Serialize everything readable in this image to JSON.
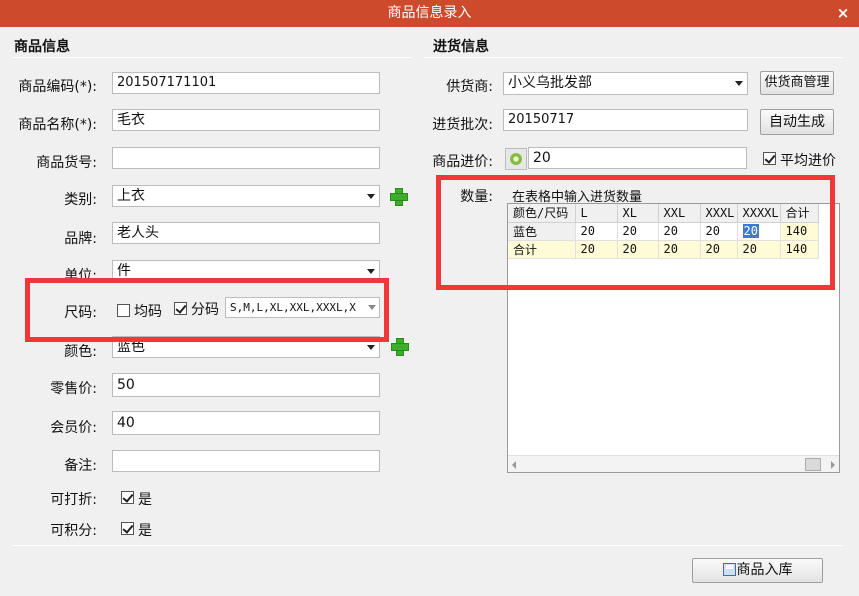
{
  "window": {
    "title": "商品信息录入",
    "close_glyph": "×"
  },
  "product": {
    "section_title": "商品信息",
    "code": {
      "label": "商品编码(*):",
      "value": "201507171101"
    },
    "name": {
      "label": "商品名称(*):",
      "value": "毛衣"
    },
    "item_no": {
      "label": "商品货号:",
      "value": ""
    },
    "category": {
      "label": "类别:",
      "value": "上衣"
    },
    "brand": {
      "label": "品牌:",
      "value": "老人头"
    },
    "unit": {
      "label": "单位:",
      "value": "件"
    },
    "size": {
      "label": "尺码:",
      "uniform_label": "均码",
      "uniform_checked": false,
      "split_label": "分码",
      "split_checked": true,
      "split_value": "S,M,L,XL,XXL,XXXL,X"
    },
    "color": {
      "label": "颜色:",
      "value": "蓝色"
    },
    "retail_price": {
      "label": "零售价:",
      "value": "50"
    },
    "member_price": {
      "label": "会员价:",
      "value": "40"
    },
    "remark": {
      "label": "备注:",
      "value": ""
    },
    "discountable": {
      "label": "可打折:",
      "option": "是",
      "checked": true
    },
    "points": {
      "label": "可积分:",
      "option": "是",
      "checked": true
    }
  },
  "purchase": {
    "section_title": "进货信息",
    "supplier": {
      "label": "供货商:",
      "value": "小义乌批发部",
      "manage_button": "供货商管理"
    },
    "batch": {
      "label": "进货批次:",
      "value": "20150717",
      "auto_button": "自动生成"
    },
    "cost": {
      "label": "商品进价:",
      "value": "20",
      "average_label": "平均进价",
      "average_checked": true
    },
    "quantity": {
      "label": "数量:",
      "hint": "在表格中输入进货数量",
      "headers": [
        "颜色/尺码",
        "L",
        "XL",
        "XXL",
        "XXXL",
        "XXXXL",
        "合计"
      ],
      "rows": [
        {
          "label": "蓝色",
          "cells": [
            "20",
            "20",
            "20",
            "20",
            "20",
            "140"
          ]
        },
        {
          "label": "合计",
          "cells": [
            "20",
            "20",
            "20",
            "20",
            "20",
            "140"
          ]
        }
      ]
    }
  },
  "footer": {
    "save_button": "商品入库"
  },
  "colors": {
    "titlebar": "#cd4b2c",
    "highlight_box": "#f2373a",
    "add_icon": "#3cae2a"
  }
}
